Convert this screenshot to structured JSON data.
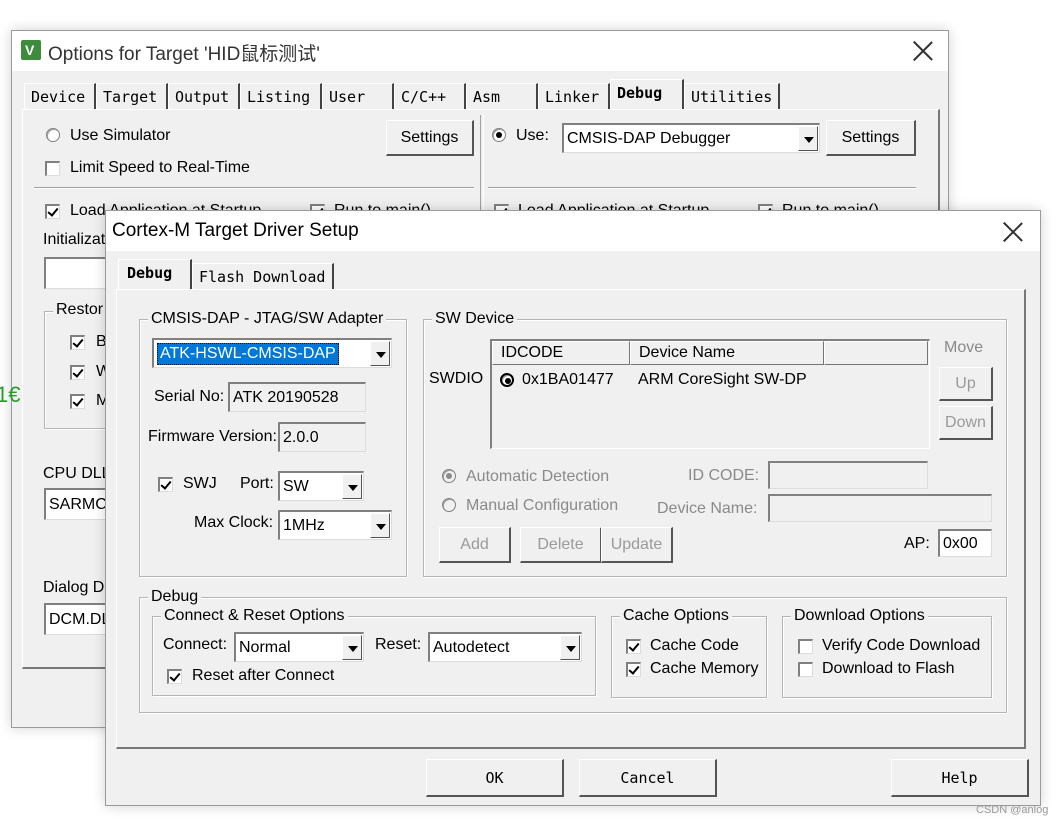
{
  "back_window": {
    "title": "Options for Target 'HID鼠标测试'",
    "tabs": [
      "Device",
      "Target",
      "Output",
      "Listing",
      "User",
      "C/C++",
      "Asm",
      "Linker",
      "Debug",
      "Utilities"
    ],
    "selected_tab": "Debug",
    "left": {
      "use_simulator_label": "Use Simulator",
      "limit_speed_label": "Limit Speed to Real-Time",
      "settings_label": "Settings",
      "load_app_label": "Load Application at Startup",
      "run_to_main_label": "Run to main()",
      "initialization_label": "Initializati",
      "restore_label": "Restor",
      "restore_items": [
        "B",
        "W",
        "M"
      ],
      "cpu_dll_label": "CPU DLL",
      "cpu_dll_value": "SARMC",
      "dialog_dll_label": "Dialog D",
      "dialog_dll_value": "DCM.DL"
    },
    "right": {
      "use_label": "Use:",
      "debugger_value": "CMSIS-DAP Debugger",
      "settings_label": "Settings",
      "load_app_label": "Load Application at Startup",
      "run_to_main_label": "Run to main()"
    },
    "side_fragment": "1€"
  },
  "front_window": {
    "title": "Cortex-M Target Driver Setup",
    "tabs": [
      "Debug",
      "Flash Download"
    ],
    "adapter": {
      "group_label": "CMSIS-DAP - JTAG/SW Adapter",
      "adapter_value": "ATK-HSWL-CMSIS-DAP",
      "serial_label": "Serial No:",
      "serial_value": "ATK 20190528",
      "firmware_label": "Firmware Version:",
      "firmware_value": "2.0.0",
      "swj_label": "SWJ",
      "port_label": "Port:",
      "port_value": "SW",
      "max_clock_label": "Max Clock:",
      "max_clock_value": "1MHz"
    },
    "sw_device": {
      "group_label": "SW Device",
      "swdio_label": "SWDIO",
      "columns": [
        "IDCODE",
        "Device Name"
      ],
      "rows": [
        {
          "idcode": "0x1BA01477",
          "device_name": "ARM CoreSight SW-DP"
        }
      ],
      "move_label": "Move",
      "up_label": "Up",
      "down_label": "Down",
      "auto_detect_label": "Automatic Detection",
      "manual_config_label": "Manual Configuration",
      "id_code_label": "ID CODE:",
      "device_name_label": "Device Name:",
      "add_label": "Add",
      "delete_label": "Delete",
      "update_label": "Update",
      "ap_label": "AP:",
      "ap_value": "0x00"
    },
    "debug": {
      "group_label": "Debug",
      "connect_reset": {
        "group_label": "Connect & Reset Options",
        "connect_label": "Connect:",
        "connect_value": "Normal",
        "reset_label": "Reset:",
        "reset_value": "Autodetect",
        "reset_after_connect_label": "Reset after Connect"
      },
      "cache": {
        "group_label": "Cache Options",
        "cache_code_label": "Cache Code",
        "cache_memory_label": "Cache Memory"
      },
      "download": {
        "group_label": "Download Options",
        "verify_label": "Verify Code Download",
        "download_flash_label": "Download to Flash"
      }
    },
    "ok_label": "OK",
    "cancel_label": "Cancel",
    "help_label": "Help"
  },
  "watermark": "CSDN @anlog",
  "colors": {
    "selection": "#0078d7",
    "keil_logo": "#3c8c3c",
    "side_fragment": "#2a9a2a"
  }
}
